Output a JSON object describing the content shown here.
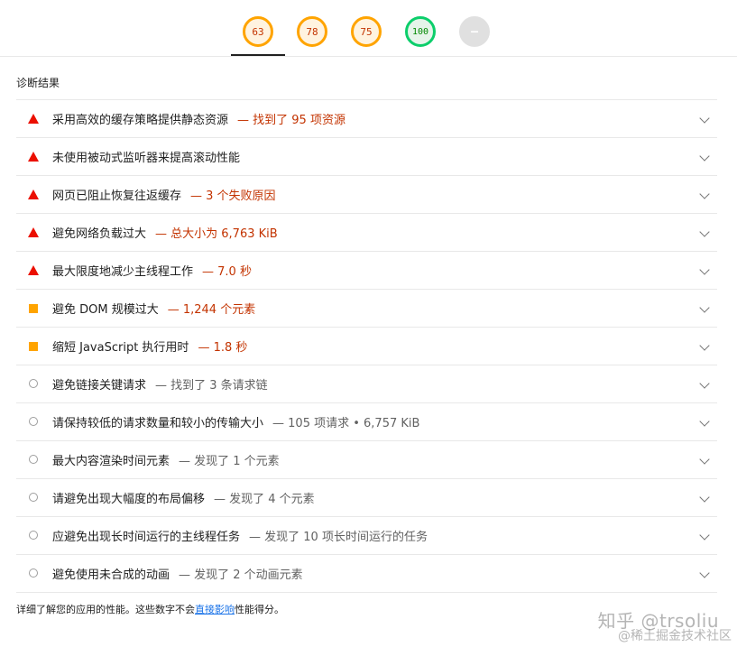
{
  "scores": [
    {
      "value": "63",
      "status": "average"
    },
    {
      "value": "78",
      "status": "average"
    },
    {
      "value": "75",
      "status": "average"
    },
    {
      "value": "100",
      "status": "pass"
    },
    {
      "value": "–",
      "status": "na"
    }
  ],
  "section_title": "诊断结果",
  "audits": [
    {
      "status": "fail",
      "title": "采用高效的缓存策略提供静态资源",
      "detail": "— 找到了 95 项资源"
    },
    {
      "status": "fail",
      "title": "未使用被动式监听器来提高滚动性能",
      "detail": ""
    },
    {
      "status": "fail",
      "title": "网页已阻止恢复往返缓存",
      "detail": "— 3 个失败原因"
    },
    {
      "status": "fail",
      "title": "避免网络负载过大",
      "detail": "— 总大小为 6,763 KiB"
    },
    {
      "status": "fail",
      "title": "最大限度地减少主线程工作",
      "detail": "— 7.0 秒"
    },
    {
      "status": "average",
      "title": "避免 DOM 规模过大",
      "detail": "— 1,244 个元素"
    },
    {
      "status": "average",
      "title": "缩短 JavaScript 执行用时",
      "detail": "— 1.8 秒"
    },
    {
      "status": "info",
      "title": "避免链接关键请求",
      "detail": "— 找到了 3 条请求链"
    },
    {
      "status": "info",
      "title": "请保持较低的请求数量和较小的传输大小",
      "detail": "— 105 项请求 • 6,757 KiB"
    },
    {
      "status": "info",
      "title": "最大内容渲染时间元素",
      "detail": "— 发现了 1 个元素"
    },
    {
      "status": "info",
      "title": "请避免出现大幅度的布局偏移",
      "detail": "— 发现了 4 个元素"
    },
    {
      "status": "info",
      "title": "应避免出现长时间运行的主线程任务",
      "detail": "— 发现了 10 项长时间运行的任务"
    },
    {
      "status": "info",
      "title": "避免使用未合成的动画",
      "detail": "— 发现了 2 个动画元素"
    }
  ],
  "footer": {
    "text_before": "详细了解您的应用的性能。这些数字不会",
    "link": "直接影响",
    "text_after": "性能得分。"
  },
  "watermark": {
    "line1": "知乎 @trsoliu",
    "line2": "@稀土掘金技术社区"
  },
  "colors": {
    "fail": "#eb0f00",
    "average": "#ffa400",
    "pass": "#0cce6b",
    "info": "#9e9e9e"
  }
}
